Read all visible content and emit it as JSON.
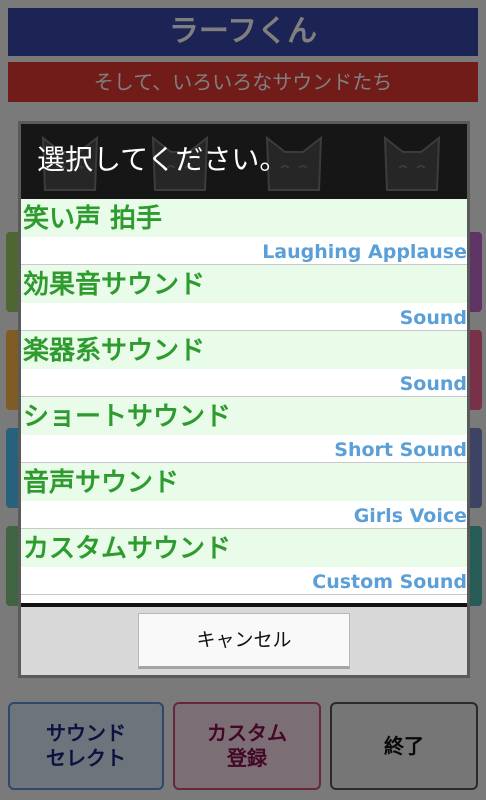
{
  "app": {
    "title": "ラーフくん",
    "subtitle": "そして、いろいろなサウンドたち"
  },
  "bottom_buttons": {
    "sound_select": "サウンド\nセレクト",
    "custom_register": "カスタム\n登録",
    "exit": "終了"
  },
  "dialog": {
    "title": "選択してください。",
    "items": [
      {
        "jp": "笑い声 拍手",
        "en": "Laughing Applause"
      },
      {
        "jp": "効果音サウンド",
        "en": "Sound"
      },
      {
        "jp": "楽器系サウンド",
        "en": "Sound"
      },
      {
        "jp": "ショートサウンド",
        "en": "Short Sound"
      },
      {
        "jp": "音声サウンド",
        "en": "Girls Voice"
      },
      {
        "jp": "カスタムサウンド",
        "en": "Custom Sound"
      }
    ],
    "cancel_label": "キャンセル"
  },
  "colors": {
    "title_bar": "#3949ab",
    "subtitle_bar": "#e53935",
    "item_jp_text": "#2e9b2e",
    "item_en_text": "#5b9fd8",
    "item_highlight": "#e9fbe9"
  }
}
